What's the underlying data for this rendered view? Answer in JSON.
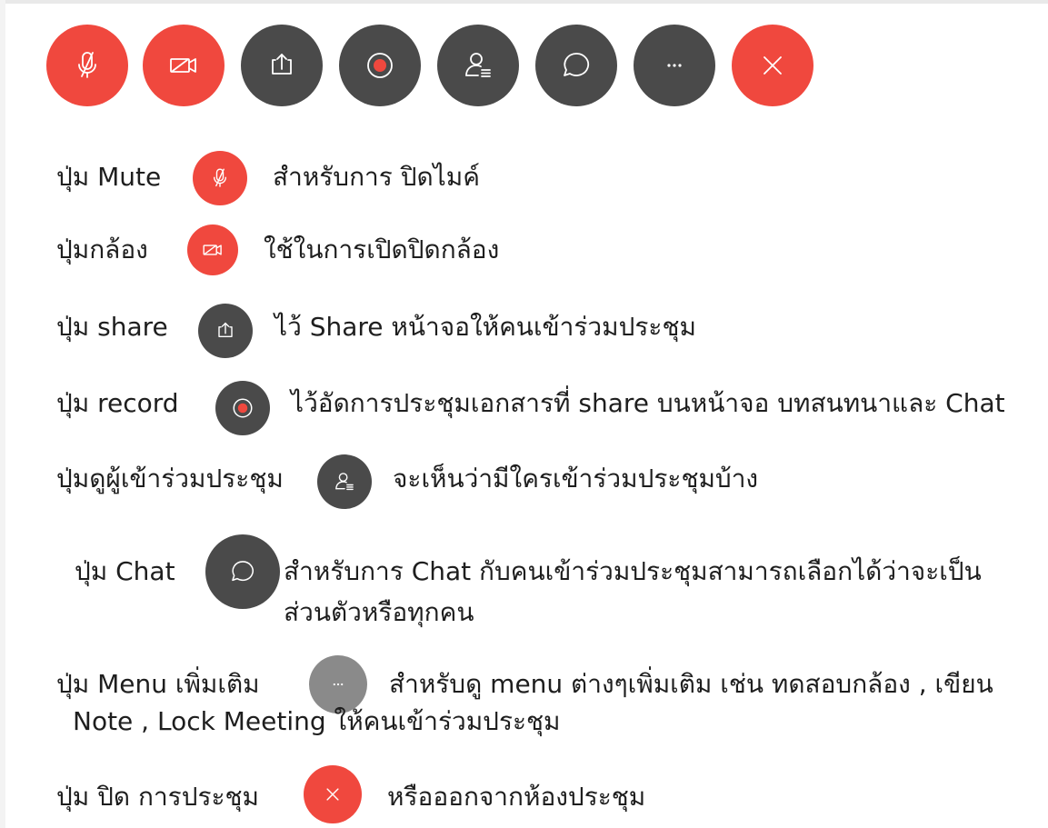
{
  "toolbar": {
    "buttons": [
      {
        "icon": "mic-off-icon",
        "color": "#f0483e"
      },
      {
        "icon": "camera-off-icon",
        "color": "#f0483e"
      },
      {
        "icon": "share-icon",
        "color": "#4a4a4a"
      },
      {
        "icon": "record-icon",
        "color": "#4a4a4a"
      },
      {
        "icon": "participants-icon",
        "color": "#4a4a4a"
      },
      {
        "icon": "chat-icon",
        "color": "#4a4a4a"
      },
      {
        "icon": "more-icon",
        "color": "#4a4a4a"
      },
      {
        "icon": "close-icon",
        "color": "#f0483e"
      }
    ]
  },
  "legend": {
    "mute": {
      "label": "ปุ่ม Mute",
      "desc": "สำหรับการ ปิดไมค์",
      "icon": "mic-off-icon"
    },
    "camera": {
      "label": "ปุ่มกล้อง",
      "desc": "ใช้ในการเปิดปิดกล้อง",
      "icon": "camera-off-icon"
    },
    "share": {
      "label": "ปุ่ม share",
      "desc": "ไว้ Share หน้าจอให้คนเข้าร่วมประชุม",
      "icon": "share-icon"
    },
    "record": {
      "label": "ปุ่ม record",
      "desc": "ไว้อัดการประชุมเอกสารที่ share บนหน้าจอ บทสนทนาและ Chat",
      "icon": "record-icon"
    },
    "participants": {
      "label": "ปุ่มดูผู้เข้าร่วมประชุม",
      "desc": "จะเห็นว่ามีใครเข้าร่วมประชุมบ้าง",
      "icon": "participants-icon"
    },
    "chat": {
      "label": "ปุ่ม Chat",
      "desc_line1": "สำหรับการ Chat กับคนเข้าร่วมประชุมสามารถเลือกได้ว่าจะเป็น",
      "desc_line2": "ส่วนตัวหรือทุกคน",
      "icon": "chat-icon"
    },
    "menu": {
      "label": "ปุ่ม Menu เพิ่มเติม",
      "desc_line1": "สำหรับดู menu ต่างๆเพิ่มเติม เช่น ทดสอบกล้อง , เขียน",
      "desc_line2": "Note , Lock Meeting ให้คนเข้าร่วมประชุม",
      "icon": "more-icon"
    },
    "end": {
      "label": "ปุ่ม ปิด การประชุม",
      "desc": "หรือออกจากห้องประชุม",
      "icon": "close-icon"
    }
  }
}
